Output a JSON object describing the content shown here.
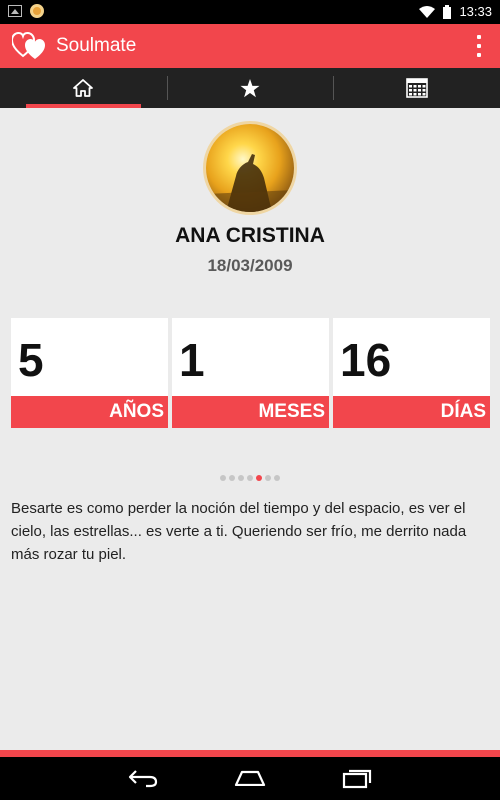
{
  "status_bar": {
    "time": "13:33",
    "left_icons": [
      "image-icon",
      "app-notification-icon"
    ],
    "right_icons": [
      "wifi-icon",
      "battery-icon"
    ]
  },
  "app_bar": {
    "title": "Soulmate",
    "logo_icon": "hearts-icon",
    "menu_icon": "overflow-menu-icon"
  },
  "tabs": [
    {
      "icon": "home-icon",
      "active": true
    },
    {
      "icon": "star-icon",
      "active": false
    },
    {
      "icon": "calendar-icon",
      "active": false
    }
  ],
  "profile": {
    "name": "ANA CRISTINA",
    "date": "18/03/2009"
  },
  "counters": [
    {
      "value": "5",
      "unit": "AÑOS"
    },
    {
      "value": "1",
      "unit": "MESES"
    },
    {
      "value": "16",
      "unit": "DÍAS"
    }
  ],
  "pager": {
    "total": 7,
    "active_index": 4
  },
  "quote": "Besarte es como perder la noción del tiempo y del espacio, es ver el cielo, las estrellas... es verte a ti. Queriendo ser frío, me derrito nada más rozar tu piel.",
  "colors": {
    "accent": "#f2464c",
    "tab_bar": "#222222",
    "background": "#ebebeb"
  },
  "nav_bar": [
    "back-icon",
    "home-icon",
    "recent-apps-icon"
  ]
}
